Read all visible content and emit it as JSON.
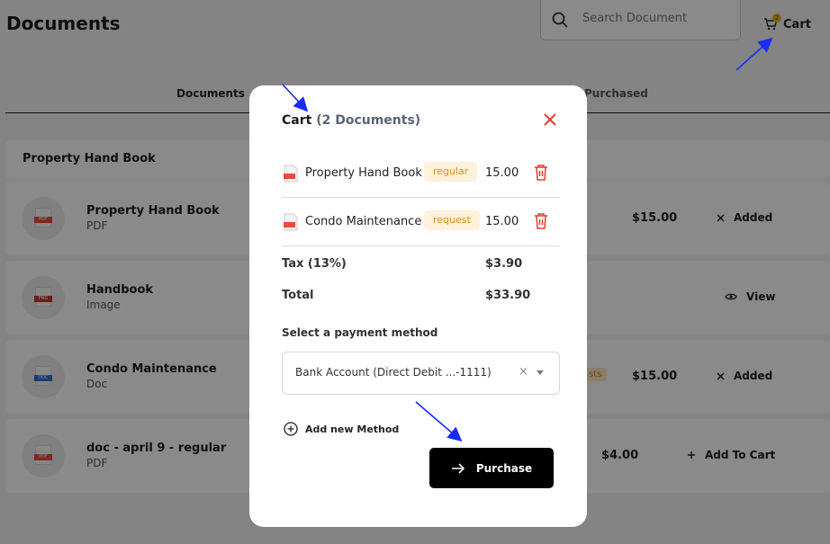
{
  "page": {
    "title": "Documents",
    "search_placeholder": "Search Document",
    "cart_label": "Cart",
    "cart_count": "2"
  },
  "tabs": [
    {
      "label": "Documents",
      "active": true
    },
    {
      "label": "Purchased",
      "active": false
    }
  ],
  "section": {
    "title": "Property Hand Book"
  },
  "documents": [
    {
      "name": "Property Hand Book",
      "type": "PDF",
      "file_badge": "PDF",
      "price": "$15.00",
      "action": "Added",
      "action_icon": "x-icon"
    },
    {
      "name": "Handbook",
      "type": "Image",
      "file_badge": "PNG",
      "price": "",
      "action": "View",
      "action_icon": "eye-icon"
    },
    {
      "name": "Condo Maintenance",
      "type": "Doc",
      "file_badge": "DOC",
      "price": "$15.00",
      "action": "Added",
      "action_icon": "x-icon",
      "tag_peek": "sts"
    },
    {
      "name": "doc - april 9 - regular",
      "type": "PDF",
      "file_badge": "PDF",
      "price": "$4.00",
      "action": "Add To Cart",
      "action_icon": "plus-icon"
    }
  ],
  "modal": {
    "title": "Cart",
    "count_label": "(2 Documents)",
    "items": [
      {
        "name": "Property Hand Book",
        "tag": "regular",
        "amount": "15.00"
      },
      {
        "name": "Condo Maintenance",
        "tag": "request",
        "amount": "15.00"
      }
    ],
    "tax_label": "Tax (13%)",
    "tax_value": "$3.90",
    "total_label": "Total",
    "total_value": "$33.90",
    "payment_label": "Select a payment method",
    "payment_selected": "Bank Account (Direct Debit ...-1111)",
    "add_method_label": "Add new Method",
    "purchase_label": "Purchase"
  },
  "colors": {
    "accent_tag_text": "#e08e1a",
    "accent_tag_bg": "#fff2dc",
    "danger": "#e53935",
    "primary_button": "#000000",
    "annotation_arrow": "#1a2bff"
  }
}
